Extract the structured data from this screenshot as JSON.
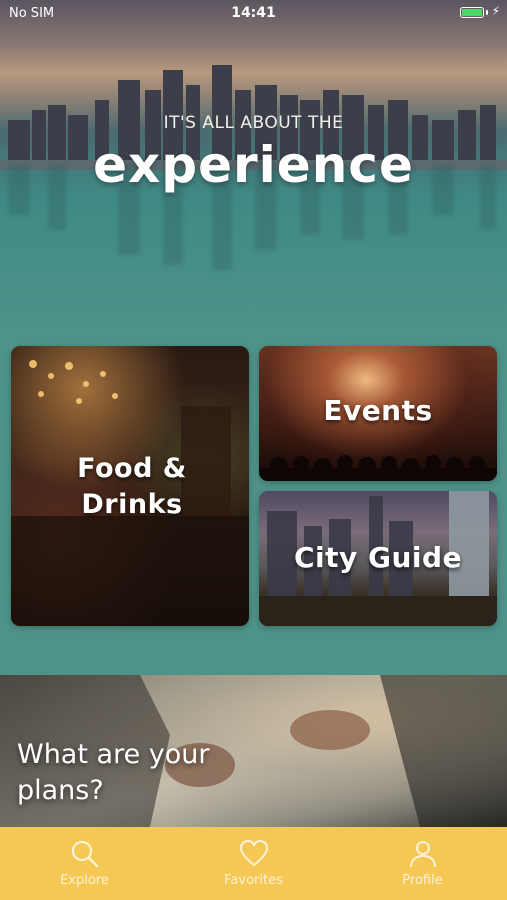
{
  "status_bar": {
    "carrier": "No SIM",
    "time": "14:41",
    "battery_level": 1.0,
    "charging": true
  },
  "hero": {
    "subtitle": "IT'S ALL ABOUT THE",
    "title": "experience"
  },
  "categories": [
    {
      "label_line1": "Food &",
      "label_line2": "Drinks"
    },
    {
      "label": "Events"
    },
    {
      "label": "City Guide"
    }
  ],
  "plans_banner": {
    "line1": "What are your",
    "line2": "plans?"
  },
  "tab_bar": {
    "items": [
      {
        "label": "Explore",
        "icon": "search-icon"
      },
      {
        "label": "Favorites",
        "icon": "heart-icon"
      },
      {
        "label": "Profile",
        "icon": "person-icon"
      }
    ]
  },
  "colors": {
    "accent": "#f5c856",
    "teal": "#4e9288"
  }
}
